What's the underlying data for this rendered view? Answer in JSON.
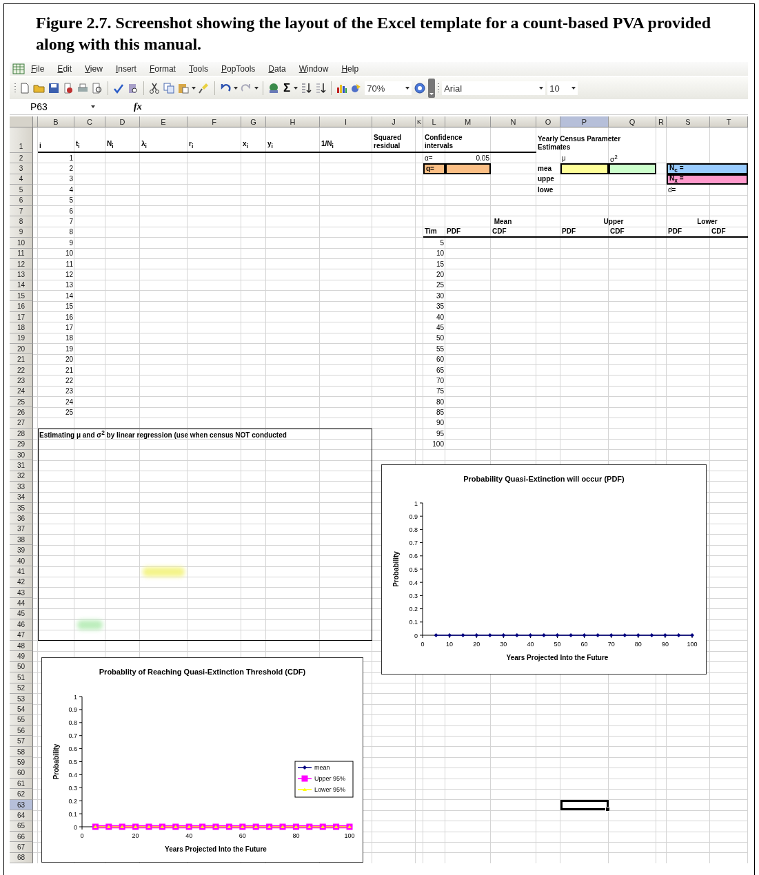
{
  "caption": "Figure 2.7. Screenshot showing the layout of the Excel template for a count-based PVA provided along with this manual.",
  "menu": [
    "File",
    "Edit",
    "View",
    "Insert",
    "Format",
    "Tools",
    "PopTools",
    "Data",
    "Window",
    "Help"
  ],
  "toolbar": {
    "autosum": "Σ",
    "zoom": "70%",
    "font": "Arial",
    "font_size": "10"
  },
  "name_box": "P63",
  "formula_label": "fx",
  "columns": [
    {
      "selected": false
    },
    {
      "label": "B",
      "selected": false
    },
    {
      "label": "C",
      "selected": false
    },
    {
      "label": "D",
      "selected": false
    },
    {
      "label": "E",
      "selected": false
    },
    {
      "label": "F",
      "selected": false
    },
    {
      "label": "G",
      "selected": false
    },
    {
      "label": "H",
      "selected": false
    },
    {
      "label": "I",
      "selected": false
    },
    {
      "label": "J",
      "selected": false
    },
    {
      "label": "K",
      "selected": false
    },
    {
      "label": "L",
      "selected": false
    },
    {
      "label": "M",
      "selected": false
    },
    {
      "label": "N",
      "selected": false
    },
    {
      "label": "O",
      "selected": false
    },
    {
      "label": "P",
      "selected": true
    },
    {
      "label": "Q",
      "selected": false
    },
    {
      "label": "R",
      "selected": false
    },
    {
      "label": "S",
      "selected": false
    },
    {
      "label": "T",
      "selected": false
    }
  ],
  "rows": [
    {
      "label": "1",
      "selected": false,
      "cells": {
        "B": {
          "text": "i",
          "kind": "label",
          "underlined": true
        },
        "C": {
          "text": "t$_{i}$",
          "kind": "label",
          "underlined": true
        },
        "D": {
          "text": "N$_{i}$",
          "kind": "label",
          "underlined": true
        },
        "E": {
          "text": "λ$_{i}$",
          "kind": "label",
          "underlined": true
        },
        "F": {
          "text": "r$_{i}$",
          "kind": "label",
          "underlined": true
        },
        "G": {
          "text": "x$_{i}$",
          "kind": "label",
          "underlined": true
        },
        "H": {
          "text": "y$_{i}$",
          "kind": "label",
          "underlined": true
        },
        "I": {
          "text": "1/N$_{i}$",
          "kind": "label",
          "underlined": true
        },
        "J": {
          "text": "Squared\nresidual",
          "kind": "label",
          "underlined": true
        },
        "L": {
          "text": "Confidence\nintervals",
          "kind": "label",
          "underlined": true
        },
        "O": {
          "text": "Yearly Census Parameter\nEstimates",
          "kind": "label"
        }
      }
    },
    {
      "label": "2",
      "selected": false,
      "cells": {
        "B": {
          "text": "1",
          "kind": "number"
        },
        "L": {
          "text": "α=",
          "kind": "text"
        },
        "M": {
          "text": "0.05",
          "kind": "number"
        },
        "P": {
          "text": "μ",
          "kind": "text"
        },
        "Q": {
          "text": "σ$^{2}$",
          "kind": "text"
        }
      }
    },
    {
      "label": "3",
      "selected": false,
      "cells": {
        "B": {
          "text": "2",
          "kind": "number"
        },
        "L": {
          "text": "q=",
          "kind": "label",
          "color": "#fbbf85",
          "boxed": true
        },
        "M": {
          "kind": "fill",
          "color": "#fbbf85",
          "boxed": true
        },
        "O": {
          "text": "mea",
          "kind": "label"
        },
        "P": {
          "kind": "fill",
          "color": "#ffff99",
          "boxed": true
        },
        "Q": {
          "kind": "fill",
          "color": "#ccffcc",
          "boxed": true
        },
        "S": {
          "text": "N$_{c}$ =",
          "kind": "label",
          "color": "#99ccff",
          "boxed": true
        }
      }
    },
    {
      "label": "4",
      "selected": false,
      "cells": {
        "B": {
          "text": "3",
          "kind": "number"
        },
        "O": {
          "text": "uppe",
          "kind": "label"
        },
        "S": {
          "text": "N$_{x}$ =",
          "kind": "label",
          "color": "#ff99cc",
          "boxed": true
        }
      }
    },
    {
      "label": "5",
      "selected": false,
      "cells": {
        "B": {
          "text": "4",
          "kind": "number"
        },
        "O": {
          "text": "lowe",
          "kind": "label"
        },
        "S": {
          "text": "d=",
          "kind": "text"
        }
      }
    },
    {
      "label": "6",
      "selected": false,
      "cells": {
        "B": {
          "text": "5",
          "kind": "number"
        }
      }
    },
    {
      "label": "7",
      "selected": false,
      "cells": {
        "B": {
          "text": "6",
          "kind": "number"
        }
      }
    },
    {
      "label": "8",
      "selected": false,
      "cells": {
        "B": {
          "text": "7",
          "kind": "number"
        },
        "M": {
          "text": "Mean",
          "kind": "title"
        },
        "P": {
          "text": "Upper",
          "kind": "title"
        },
        "S": {
          "text": "Lower",
          "kind": "title"
        }
      }
    },
    {
      "label": "9",
      "selected": false,
      "cells": {
        "B": {
          "text": "8",
          "kind": "number"
        },
        "L": {
          "text": "Tim",
          "kind": "label",
          "underlined": true
        },
        "M": {
          "text": "PDF",
          "kind": "label",
          "underlined": true
        },
        "N": {
          "text": "CDF",
          "kind": "label",
          "underlined": true
        },
        "P": {
          "text": "PDF",
          "kind": "label",
          "underlined": true
        },
        "Q": {
          "text": "CDF",
          "kind": "label",
          "underlined": true
        },
        "S": {
          "text": "PDF",
          "kind": "label",
          "underlined": true
        },
        "T": {
          "text": "CDF",
          "kind": "label",
          "underlined": true
        }
      }
    },
    {
      "label": "10",
      "selected": false,
      "cells": {
        "B": {
          "text": "9",
          "kind": "number"
        },
        "L": {
          "text": "5",
          "kind": "number"
        }
      }
    },
    {
      "label": "11",
      "selected": false,
      "cells": {
        "B": {
          "text": "10",
          "kind": "number"
        },
        "L": {
          "text": "10",
          "kind": "number"
        }
      }
    },
    {
      "label": "12",
      "selected": false,
      "cells": {
        "B": {
          "text": "11",
          "kind": "number"
        },
        "L": {
          "text": "15",
          "kind": "number"
        }
      }
    },
    {
      "label": "13",
      "selected": false,
      "cells": {
        "B": {
          "text": "12",
          "kind": "number"
        },
        "L": {
          "text": "20",
          "kind": "number"
        }
      }
    },
    {
      "label": "14",
      "selected": false,
      "cells": {
        "B": {
          "text": "13",
          "kind": "number"
        },
        "L": {
          "text": "25",
          "kind": "number"
        }
      }
    },
    {
      "label": "15",
      "selected": false,
      "cells": {
        "B": {
          "text": "14",
          "kind": "number"
        },
        "L": {
          "text": "30",
          "kind": "number"
        }
      }
    },
    {
      "label": "16",
      "selected": false,
      "cells": {
        "B": {
          "text": "15",
          "kind": "number"
        },
        "L": {
          "text": "35",
          "kind": "number"
        }
      }
    },
    {
      "label": "17",
      "selected": false,
      "cells": {
        "B": {
          "text": "16",
          "kind": "number"
        },
        "L": {
          "text": "40",
          "kind": "number"
        }
      }
    },
    {
      "label": "18",
      "selected": false,
      "cells": {
        "B": {
          "text": "17",
          "kind": "number"
        },
        "L": {
          "text": "45",
          "kind": "number"
        }
      }
    },
    {
      "label": "19",
      "selected": false,
      "cells": {
        "B": {
          "text": "18",
          "kind": "number"
        },
        "L": {
          "text": "50",
          "kind": "number"
        }
      }
    },
    {
      "label": "20",
      "selected": false,
      "cells": {
        "B": {
          "text": "19",
          "kind": "number"
        },
        "L": {
          "text": "55",
          "kind": "number"
        }
      }
    },
    {
      "label": "21",
      "selected": false,
      "cells": {
        "B": {
          "text": "20",
          "kind": "number"
        },
        "L": {
          "text": "60",
          "kind": "number"
        }
      }
    },
    {
      "label": "22",
      "selected": false,
      "cells": {
        "B": {
          "text": "21",
          "kind": "number"
        },
        "L": {
          "text": "65",
          "kind": "number"
        }
      }
    },
    {
      "label": "23",
      "selected": false,
      "cells": {
        "B": {
          "text": "22",
          "kind": "number"
        },
        "L": {
          "text": "70",
          "kind": "number"
        }
      }
    },
    {
      "label": "24",
      "selected": false,
      "cells": {
        "B": {
          "text": "23",
          "kind": "number"
        },
        "L": {
          "text": "75",
          "kind": "number"
        }
      }
    },
    {
      "label": "25",
      "selected": false,
      "cells": {
        "B": {
          "text": "24",
          "kind": "number"
        },
        "L": {
          "text": "80",
          "kind": "number"
        }
      }
    },
    {
      "label": "26",
      "selected": false,
      "cells": {
        "B": {
          "text": "25",
          "kind": "number"
        },
        "L": {
          "text": "85",
          "kind": "number"
        }
      }
    },
    {
      "label": "27",
      "selected": false,
      "cells": {
        "L": {
          "text": "90",
          "kind": "number"
        }
      }
    },
    {
      "label": "28",
      "selected": false,
      "cells": {
        "B": {
          "text": "Estimating μ and σ$^{2}$ by linear regression (use when census NOT conducted",
          "kind": "label"
        },
        "L": {
          "text": "95",
          "kind": "number"
        }
      }
    },
    {
      "label": "29",
      "selected": false,
      "cells": {
        "L": {
          "text": "100",
          "kind": "number"
        }
      }
    },
    {
      "label": "30",
      "selected": false
    },
    {
      "label": "31",
      "selected": false
    },
    {
      "label": "32",
      "selected": false
    },
    {
      "label": "33",
      "selected": false
    },
    {
      "label": "34",
      "selected": false
    },
    {
      "label": "35",
      "selected": false
    },
    {
      "label": "36",
      "selected": false
    },
    {
      "label": "37",
      "selected": false
    },
    {
      "label": "38",
      "selected": false
    },
    {
      "label": "39",
      "selected": false
    },
    {
      "label": "40",
      "selected": false
    },
    {
      "label": "41",
      "selected": false,
      "cells": {
        "E": {
          "kind": "smudge",
          "color": "#f4f48a"
        }
      }
    },
    {
      "label": "42",
      "selected": false
    },
    {
      "label": "43",
      "selected": false
    },
    {
      "label": "44",
      "selected": false
    },
    {
      "label": "45",
      "selected": false
    },
    {
      "label": "46",
      "selected": false,
      "cells": {
        "C": {
          "kind": "smudge",
          "color": "#bdeebd"
        }
      }
    },
    {
      "label": "47",
      "selected": false
    },
    {
      "label": "48",
      "selected": false
    },
    {
      "label": "49",
      "selected": false
    },
    {
      "label": "50",
      "selected": false
    },
    {
      "label": "51",
      "selected": false
    },
    {
      "label": "52",
      "selected": false
    },
    {
      "label": "53",
      "selected": false
    },
    {
      "label": "54",
      "selected": false
    },
    {
      "label": "55",
      "selected": false
    },
    {
      "label": "56",
      "selected": false
    },
    {
      "label": "57",
      "selected": false
    },
    {
      "label": "58",
      "selected": false
    },
    {
      "label": "59",
      "selected": false
    },
    {
      "label": "60",
      "selected": false
    },
    {
      "label": "61",
      "selected": false
    },
    {
      "label": "62",
      "selected": false
    },
    {
      "label": "63",
      "selected": true,
      "cells": {
        "P": {
          "kind": "fill",
          "selected": true
        }
      }
    },
    {
      "label": "64",
      "selected": false
    },
    {
      "label": "65",
      "selected": false
    },
    {
      "label": "66",
      "selected": false
    },
    {
      "label": "67",
      "selected": false
    },
    {
      "label": "68",
      "selected": false
    }
  ],
  "charts": [
    {
      "chart_data": {
        "type": "line",
        "title": "Probability Quasi-Extinction will occur (PDF)",
        "xlabel": "Years Projected Into the Future",
        "ylabel": "Probability",
        "x": [
          5,
          10,
          15,
          20,
          25,
          30,
          35,
          40,
          45,
          50,
          55,
          60,
          65,
          70,
          75,
          80,
          85,
          90,
          95,
          100
        ],
        "series": [
          {
            "color": "#000080",
            "marker": "diamond",
            "values": [
              0,
              0,
              0,
              0,
              0,
              0,
              0,
              0,
              0,
              0,
              0,
              0,
              0,
              0,
              0,
              0,
              0,
              0,
              0,
              0
            ]
          }
        ],
        "xlim": [
          0,
          100
        ],
        "ylim": [
          0,
          1
        ],
        "xticks": [
          0,
          10,
          20,
          30,
          40,
          50,
          60,
          70,
          80,
          90,
          100
        ],
        "yticks": [
          0,
          0.1,
          0.2,
          0.3,
          0.4,
          0.5,
          0.6,
          0.7,
          0.8,
          0.9,
          1
        ]
      }
    },
    {
      "chart_data": {
        "type": "line",
        "title": "Probablity of Reaching Quasi-Extinction Threshold (CDF)",
        "xlabel": "Years Projected Into the Future",
        "ylabel": "Probability",
        "x": [
          5,
          10,
          15,
          20,
          25,
          30,
          35,
          40,
          45,
          50,
          55,
          60,
          65,
          70,
          75,
          80,
          85,
          90,
          95,
          100
        ],
        "series": [
          {
            "name": "mean",
            "color": "#000080",
            "marker": "diamond",
            "values": [
              null,
              null,
              null,
              null,
              null,
              null,
              null,
              null,
              null,
              null,
              null,
              null,
              null,
              null,
              null,
              null,
              null,
              null,
              null,
              null
            ]
          },
          {
            "name": "Upper 95%",
            "color": "#ff00ff",
            "marker": "square",
            "values": [
              0,
              0,
              0,
              0,
              0,
              0,
              0,
              0,
              0,
              0,
              0,
              0,
              0,
              0,
              0,
              0,
              0,
              0,
              0,
              0
            ]
          },
          {
            "name": "Lower 95%",
            "color": "#ffff00",
            "marker": "triangle",
            "values": [
              0,
              0,
              0,
              0,
              0,
              0,
              0,
              0,
              0,
              0,
              0,
              0,
              0,
              0,
              0,
              0,
              0,
              0,
              0,
              0
            ]
          }
        ],
        "legend": "right",
        "xlim": [
          0,
          100
        ],
        "ylim": [
          0,
          1
        ],
        "xticks": [
          0,
          20,
          40,
          60,
          80,
          100
        ],
        "yticks": [
          0,
          0.1,
          0.2,
          0.3,
          0.4,
          0.5,
          0.6,
          0.7,
          0.8,
          0.9,
          1
        ]
      }
    }
  ]
}
